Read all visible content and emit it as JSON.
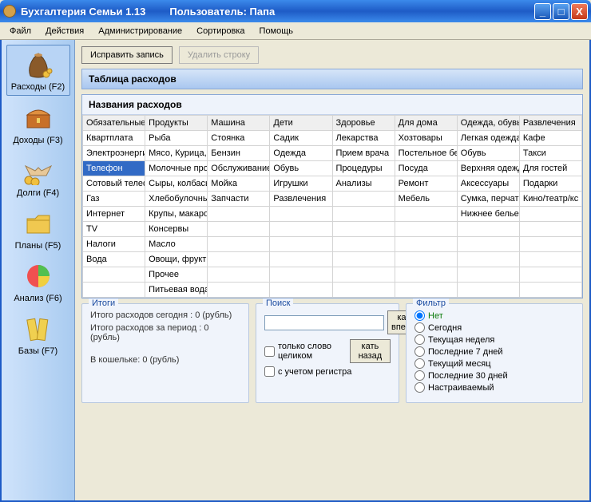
{
  "window": {
    "title_app": "Бухгалтерия Семьи 1.13",
    "title_user": "Пользователь: Папа",
    "min": "_",
    "max": "□",
    "close": "X"
  },
  "menu": [
    "Файл",
    "Действия",
    "Администрирование",
    "Сортировка",
    "Помощь"
  ],
  "sidebar": [
    {
      "label": "Расходы (F2)"
    },
    {
      "label": "Доходы (F3)"
    },
    {
      "label": "Долги (F4)"
    },
    {
      "label": "Планы (F5)"
    },
    {
      "label": "Анализ (F6)"
    },
    {
      "label": "Базы (F7)"
    }
  ],
  "toolbar": {
    "edit": "Исправить запись",
    "delete": "Удалить строку"
  },
  "panel": {
    "title": "Таблица расходов",
    "subtitle": "Названия расходов"
  },
  "columns": [
    "Обязательные",
    "Продукты",
    "Машина",
    "Дети",
    "Здоровье",
    "Для дома",
    "Одежда, обувь",
    "Развлечения"
  ],
  "rows": [
    [
      "Квартплата",
      "Рыба",
      "Стоянка",
      "Садик",
      "Лекарства",
      "Хозтовары",
      "Легкая одежда",
      "Кафе"
    ],
    [
      "Электроэнергия",
      "Мясо, Курица,",
      "Бензин",
      "Одежда",
      "Прием врача",
      "Постельное белье",
      "Обувь",
      "Такси"
    ],
    [
      "Телефон",
      "Молочные продукты",
      "Обслуживание",
      "Обувь",
      "Процедуры",
      "Посуда",
      "Верхняя одежда",
      "Для гостей"
    ],
    [
      "Сотовый телефон",
      "Сыры, колбасы",
      "Мойка",
      "Игрушки",
      "Анализы",
      "Ремонт",
      "Аксессуары",
      "Подарки"
    ],
    [
      "Газ",
      "Хлебобулочные",
      "Запчасти",
      "Развлечения",
      "",
      "Мебель",
      "Сумка, перчатки",
      "Кино/театр/кс"
    ],
    [
      "Интернет",
      "Крупы, макароны",
      "",
      "",
      "",
      "",
      "Нижнее белье",
      ""
    ],
    [
      "TV",
      "Консервы",
      "",
      "",
      "",
      "",
      "",
      ""
    ],
    [
      "Налоги",
      "Масло",
      "",
      "",
      "",
      "",
      "",
      ""
    ],
    [
      "Вода",
      "Овощи, фрукты",
      "",
      "",
      "",
      "",
      "",
      ""
    ],
    [
      "",
      "Прочее",
      "",
      "",
      "",
      "",
      "",
      ""
    ],
    [
      "",
      "Питьевая вода",
      "",
      "",
      "",
      "",
      "",
      ""
    ]
  ],
  "selected_cell": {
    "row": 2,
    "col": 0
  },
  "totals": {
    "legend": "Итоги",
    "line1": "Итого расходов сегодня : 0 (рубль)",
    "line2": "Итого расходов за период : 0 (рубль)",
    "line3": "В кошельке: 0 (рубль)"
  },
  "search": {
    "legend": "Поиск",
    "placeholder": "",
    "btn_fwd": "кать вперед",
    "btn_back": "кать назад",
    "chk_whole": "только слово целиком",
    "chk_case": "с учетом регистра"
  },
  "filter": {
    "legend": "Фильтр",
    "options": [
      "Нет",
      "Сегодня",
      "Текущая неделя",
      "Последние 7 дней",
      "Текущий месяц",
      "Последние 30 дней",
      "Настраиваемый"
    ],
    "selected": 0
  }
}
